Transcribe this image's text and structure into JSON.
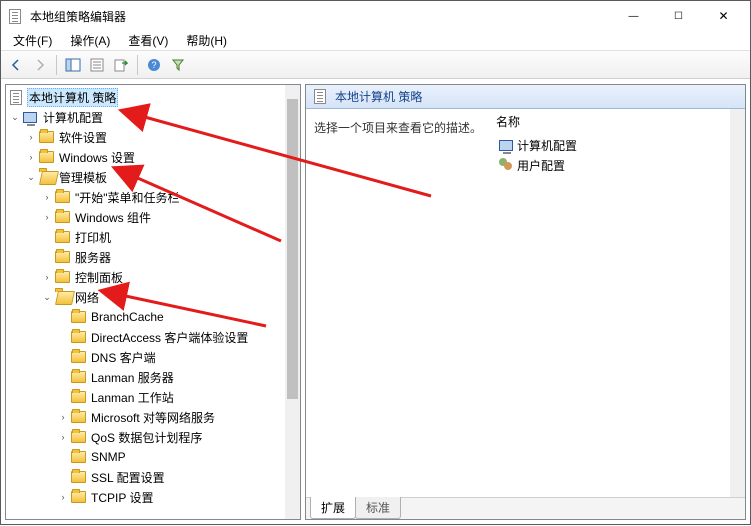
{
  "window": {
    "title": "本地组策略编辑器",
    "btn_min": "—",
    "btn_max": "☐",
    "btn_close": "✕"
  },
  "menu": {
    "file": "文件(F)",
    "action": "操作(A)",
    "view": "查看(V)",
    "help": "帮助(H)"
  },
  "tree": {
    "root": "本地计算机 策略",
    "computer_config": "计算机配置",
    "software_settings": "软件设置",
    "windows_settings": "Windows 设置",
    "admin_templates": "管理模板",
    "start_menu": "\"开始\"菜单和任务栏",
    "windows_components": "Windows 组件",
    "printers": "打印机",
    "servers": "服务器",
    "control_panel": "控制面板",
    "network": "网络",
    "branchcache": "BranchCache",
    "directaccess": "DirectAccess 客户端体验设置",
    "dns_client": "DNS 客户端",
    "lanman_server": "Lanman 服务器",
    "lanman_workstation": "Lanman 工作站",
    "ms_p2p": "Microsoft 对等网络服务",
    "qos": "QoS 数据包计划程序",
    "snmp": "SNMP",
    "ssl_config": "SSL 配置设置",
    "tcpip": "TCPIP 设置",
    "twist_open": "⌄",
    "twist_closed": "›"
  },
  "right": {
    "header": "本地计算机 策略",
    "description": "选择一个项目来查看它的描述。",
    "col_name": "名称",
    "item_computer": "计算机配置",
    "item_user": "用户配置",
    "tab_extended": "扩展",
    "tab_standard": "标准"
  }
}
